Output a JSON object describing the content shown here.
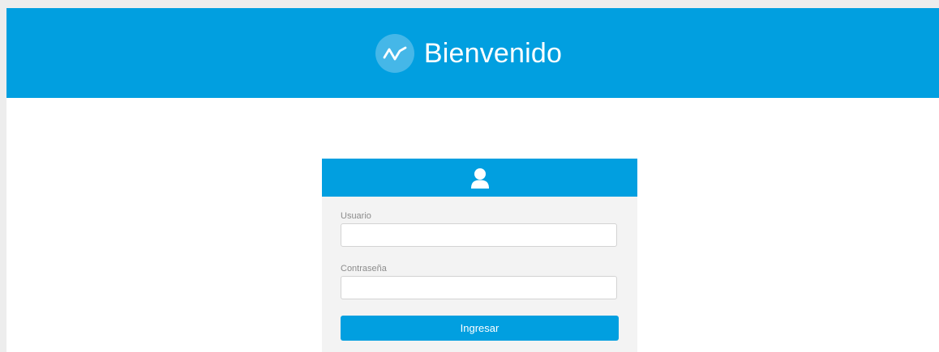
{
  "header": {
    "title": "Bienvenido",
    "logo_icon": "activity-wave-icon",
    "background_color": "#019fe0"
  },
  "login_card": {
    "header_icon": "user-icon",
    "username": {
      "label": "Usuario",
      "value": "",
      "placeholder": ""
    },
    "password": {
      "label": "Contraseña",
      "value": "",
      "placeholder": ""
    },
    "submit_label": "Ingresar"
  },
  "colors": {
    "accent": "#019fe0",
    "logo_circle": "#45b7e8",
    "card_background": "#f3f3f3",
    "page_background": "#ededed"
  }
}
